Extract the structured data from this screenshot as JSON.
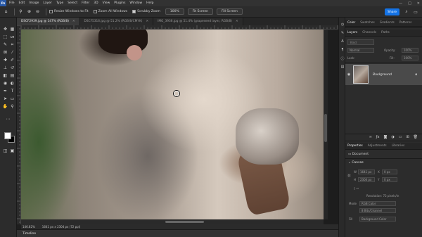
{
  "app": {
    "logo": "Ps"
  },
  "menu": [
    "File",
    "Edit",
    "Image",
    "Layer",
    "Type",
    "Select",
    "Filter",
    "3D",
    "View",
    "Plugins",
    "Window",
    "Help"
  ],
  "window_controls": [
    "—",
    "□",
    "✕"
  ],
  "options": {
    "home_icon": "home-icon",
    "zoom_in_icon": "zoom-in-icon",
    "zoom_out_icon": "zoom-out-icon",
    "resize_windows_label": "Resize Windows to Fit",
    "resize_windows_checked": false,
    "zoom_all_label": "Zoom All Windows",
    "zoom_all_checked": false,
    "scrubby_label": "Scrubby Zoom",
    "scrubby_checked": true,
    "zoom_100_label": "100%",
    "fit_screen_label": "Fit Screen",
    "fill_screen_label": "Fill Screen",
    "share_label": "Share"
  },
  "tabs": [
    {
      "label": "DSCF2939.jpg @ 147% (RGB/8)",
      "active": true
    },
    {
      "label": "DSCF5316.jpg @ 51.2% (RGB/8/CMYK)",
      "active": false
    },
    {
      "label": "IMG_3936.jpg @ 51.4% (grapeseed layer, RGB/8)",
      "active": false
    }
  ],
  "status": {
    "zoom": "146.82%",
    "dimensions": "1641 px x 2304 px (72 ppi)"
  },
  "timeline_label": "Timeline",
  "panels": {
    "top_tabs": [
      "Color",
      "Swatches",
      "Gradients",
      "Patterns"
    ],
    "layer_tabs": [
      "Layers",
      "Channels",
      "Paths"
    ],
    "layers_search": "Kind",
    "blend_mode": "Normal",
    "opacity_label": "Opacity:",
    "opacity_value": "100%",
    "lock_label": "Lock:",
    "fill_label": "Fill:",
    "fill_value": "100%",
    "layer_name": "Background",
    "props_tabs": [
      "Properties",
      "Adjustments",
      "Libraries"
    ],
    "document_label": "Document",
    "canvas_label": "Canvas",
    "width_label": "W",
    "width_value": "1641 px",
    "x_label": "X",
    "x_value": "0 px",
    "height_label": "H",
    "height_value": "2304 px",
    "y_label": "Y",
    "y_value": "0 px",
    "resolution": "Resolution: 72 pixels/in",
    "mode_label": "Mode",
    "mode_value": "RGB Color",
    "depth_value": "8 Bits/Channel",
    "fill_label2": "Fill",
    "fill_value2": "Background Color"
  },
  "colors": {
    "accent": "#1473e6",
    "foreground": "#ffffff",
    "background": "#000000"
  }
}
